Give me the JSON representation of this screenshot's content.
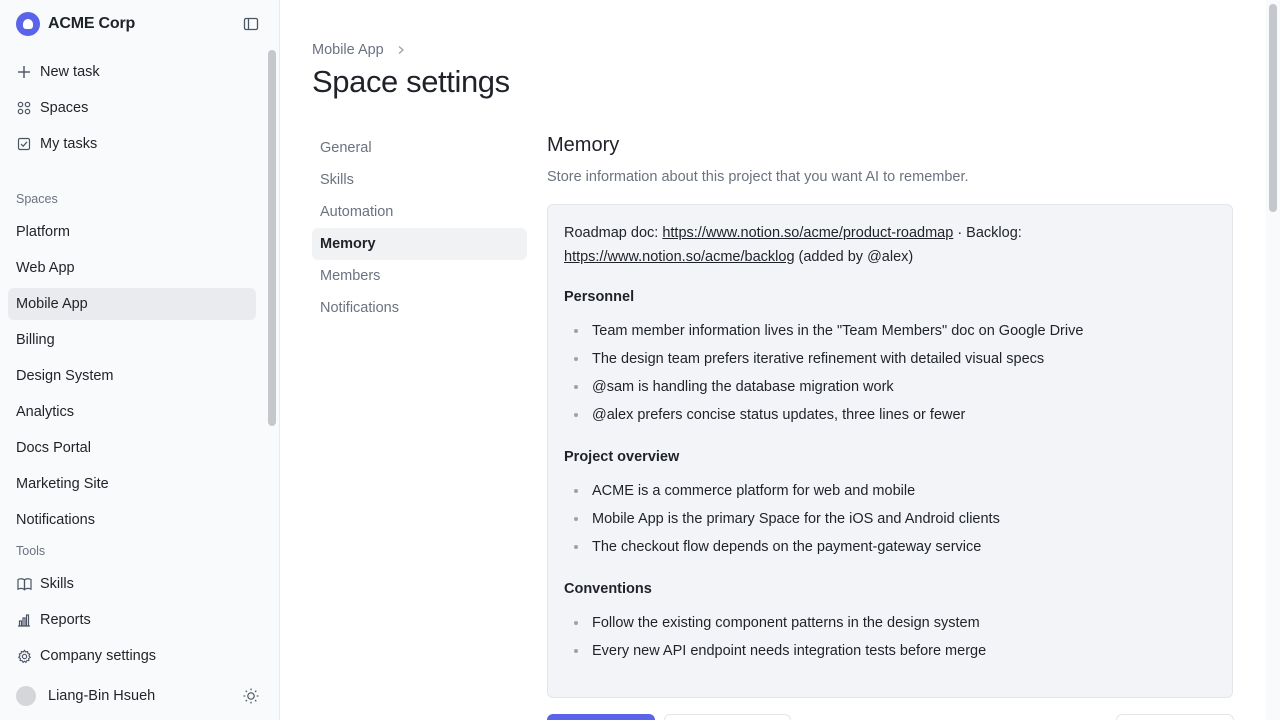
{
  "brand": {
    "name": "ACME Corp",
    "accent": "#5b63e8"
  },
  "sidebar": {
    "actions": [
      {
        "label": "New task",
        "icon": "plus-icon"
      },
      {
        "label": "Spaces",
        "icon": "grid-icon"
      },
      {
        "label": "My tasks",
        "icon": "checkbox-icon"
      }
    ],
    "spaces_label": "Spaces",
    "spaces": [
      {
        "label": "Platform"
      },
      {
        "label": "Web App"
      },
      {
        "label": "Mobile App",
        "active": true
      },
      {
        "label": "Billing"
      },
      {
        "label": "Design System"
      },
      {
        "label": "Analytics"
      },
      {
        "label": "Docs Portal"
      },
      {
        "label": "Marketing Site"
      },
      {
        "label": "Notifications"
      }
    ],
    "tools_label": "Tools",
    "tools": [
      {
        "label": "Skills",
        "icon": "book-icon"
      },
      {
        "label": "Reports",
        "icon": "bar-chart-icon"
      },
      {
        "label": "Company settings",
        "icon": "gear-icon"
      }
    ],
    "user": {
      "name": "Liang-Bin Hsueh"
    }
  },
  "main": {
    "breadcrumb": "Mobile App",
    "title": "Space settings",
    "subnav": [
      {
        "label": "General"
      },
      {
        "label": "Skills"
      },
      {
        "label": "Automation"
      },
      {
        "label": "Memory",
        "active": true
      },
      {
        "label": "Members"
      },
      {
        "label": "Notifications"
      }
    ],
    "memory": {
      "title": "Memory",
      "description": "Store information about this project that you want AI to remember.",
      "intro": {
        "roadmap_prefix": "Roadmap doc: ",
        "roadmap_link": "https://www.notion.so/acme/product-roadmap",
        "backlog_prefix": " · Backlog: ",
        "backlog_link": "https://www.notion.so/acme/backlog",
        "suffix": " (added by @alex)"
      },
      "sections": [
        {
          "heading": "Personnel",
          "items": [
            "Team member information lives in the \"Team Members\" doc on Google Drive",
            "The design team prefers iterative refinement with detailed visual specs",
            "@sam is handling the database migration work",
            "@alex prefers concise status updates, three lines or fewer"
          ]
        },
        {
          "heading": "Project overview",
          "items": [
            "ACME is a commerce platform for web and mobile",
            "Mobile App is the primary Space for the iOS and Android clients",
            "The checkout flow depends on the payment-gateway service"
          ]
        },
        {
          "heading": "Conventions",
          "items": [
            "Follow the existing component patterns in the design system",
            "Every new API endpoint needs integration tests before merge"
          ]
        }
      ]
    }
  }
}
